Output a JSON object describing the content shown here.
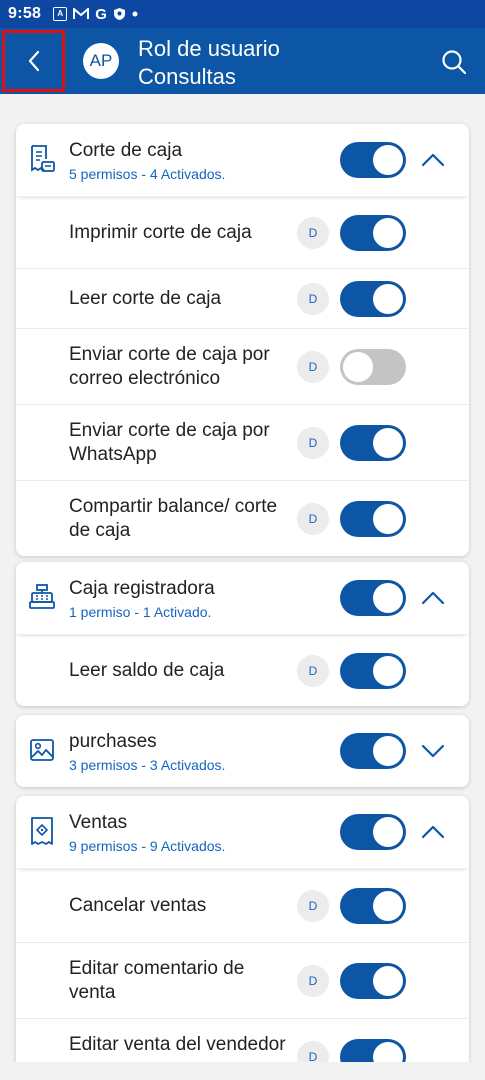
{
  "status_bar": {
    "time": "9:58",
    "icons": [
      "a-square-icon",
      "gmail-icon",
      "google-icon",
      "shield-icon",
      "dot-icon"
    ],
    "icon_glyphs": {
      "a": "A",
      "g": "G"
    }
  },
  "app_bar": {
    "avatar_initials": "AP",
    "title_line1": "Rol de usuario",
    "title_line2": "Consultas"
  },
  "sections": [
    {
      "title": "Corte de caja",
      "subtitle": "5 permisos - 4 Activados.",
      "enabled": true,
      "expanded": true,
      "items": [
        {
          "label": "Imprimir corte de caja",
          "badge": "D",
          "enabled": true
        },
        {
          "label": "Leer corte de caja",
          "badge": "D",
          "enabled": true
        },
        {
          "label": "Enviar corte de caja por correo electrónico",
          "badge": "D",
          "enabled": false
        },
        {
          "label": "Enviar corte de caja por WhatsApp",
          "badge": "D",
          "enabled": true
        },
        {
          "label": "Compartir balance/ corte de caja",
          "badge": "D",
          "enabled": true
        }
      ]
    },
    {
      "title": "Caja registradora",
      "subtitle": "1 permiso - 1 Activado.",
      "enabled": true,
      "expanded": true,
      "items": [
        {
          "label": "Leer saldo de caja",
          "badge": "D",
          "enabled": true
        }
      ]
    },
    {
      "title": "purchases",
      "subtitle": "3 permisos - 3 Activados.",
      "enabled": true,
      "expanded": false,
      "items": []
    },
    {
      "title": "Ventas",
      "subtitle": "9 permisos - 9 Activados.",
      "enabled": true,
      "expanded": true,
      "items": [
        {
          "label": "Cancelar ventas",
          "badge": "D",
          "enabled": true
        },
        {
          "label": "Editar comentario de venta",
          "badge": "D",
          "enabled": true
        },
        {
          "label": "Editar venta del vendedor",
          "badge": "D",
          "enabled": true
        }
      ]
    }
  ],
  "colors": {
    "primary": "#0d56a6",
    "status_bar": "#0d47a1",
    "accent_text": "#1565c0",
    "toggle_off": "#c4c4c4",
    "highlight_box": "#e01010"
  }
}
